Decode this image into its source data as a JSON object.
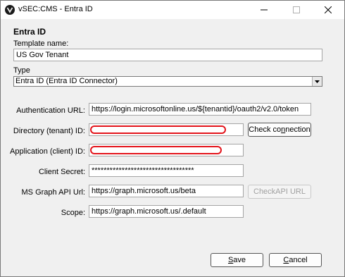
{
  "window": {
    "title": "vSEC:CMS - Entra ID"
  },
  "heading": "Entra ID",
  "template": {
    "label": "Template name:",
    "value": "US Gov Tenant"
  },
  "type": {
    "label": "Type",
    "selected": "Entra ID (Entra ID Connector)"
  },
  "fields": {
    "auth_url": {
      "label": "Authentication URL:",
      "value": "https://login.microsoftonline.us/${tenantid}/oauth2/v2.0/token"
    },
    "directory_id": {
      "label": "Directory (tenant) ID:",
      "value": ""
    },
    "application_id": {
      "label": "Application (client) ID:",
      "value": ""
    },
    "client_secret": {
      "label": "Client Secret:",
      "value": "**********************************"
    },
    "graph_url": {
      "label": "MS Graph API Url:",
      "value": "https://graph.microsoft.us/beta"
    },
    "scope": {
      "label": "Scope:",
      "value": "https://graph.microsoft.us/.default"
    }
  },
  "buttons": {
    "check_connection_pre": "Check co",
    "check_connection_key": "n",
    "check_connection_post": "nection",
    "check_api_url": "CheckAPI URL",
    "save_key": "S",
    "save_post": "ave",
    "cancel_key": "C",
    "cancel_post": "ancel"
  },
  "colors": {
    "redaction": "#e3141b",
    "background": "#f0f0f0"
  }
}
